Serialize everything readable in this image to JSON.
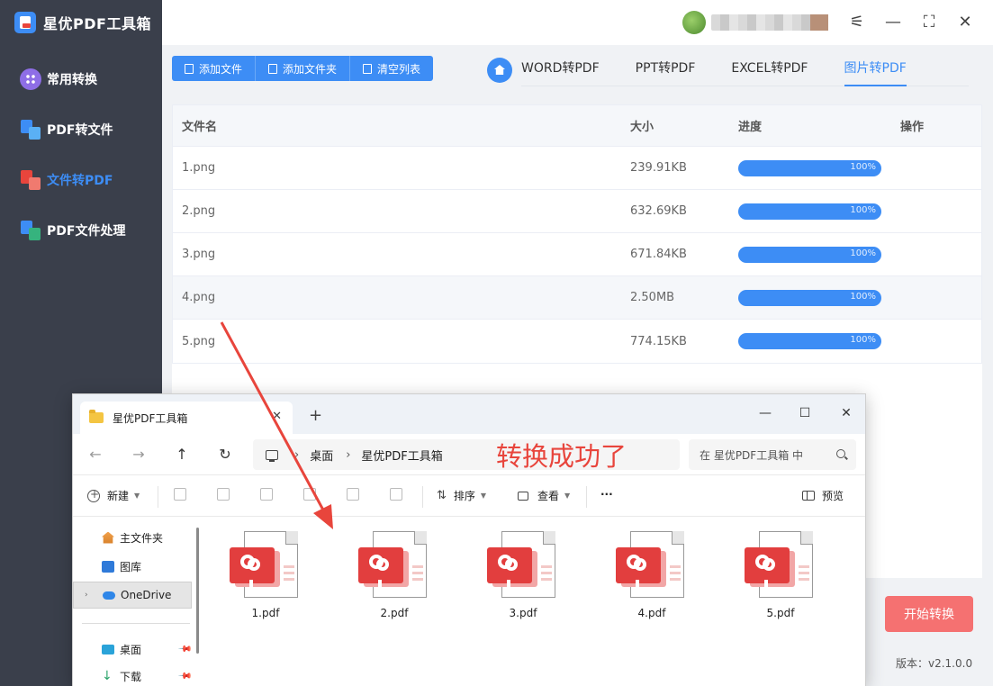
{
  "app": {
    "title": "星优PDF工具箱",
    "accent_color": "#3d8df5",
    "version_label": "版本：v2.1.0.0"
  },
  "sidebar": {
    "items": [
      {
        "label": "常用转换",
        "icon": "grid-icon"
      },
      {
        "label": "PDF转文件",
        "icon": "pdf-to-file-icon"
      },
      {
        "label": "文件转PDF",
        "icon": "file-to-pdf-icon",
        "active": true
      },
      {
        "label": "PDF文件处理",
        "icon": "pdf-process-icon"
      }
    ]
  },
  "window_controls": [
    "settings-icon",
    "minimize-icon",
    "maximize-icon",
    "close-icon"
  ],
  "toolbar": {
    "add_file": "添加文件",
    "add_folder": "添加文件夹",
    "clear_list": "清空列表"
  },
  "tabs": [
    {
      "label": "WORD转PDF"
    },
    {
      "label": "PPT转PDF"
    },
    {
      "label": "EXCEL转PDF"
    },
    {
      "label": "图片转PDF",
      "active": true
    }
  ],
  "table": {
    "headers": {
      "name": "文件名",
      "size": "大小",
      "progress": "进度",
      "action": "操作"
    },
    "rows": [
      {
        "name": "1.png",
        "size": "239.91KB",
        "progress_label": "100%",
        "progress": 1.0
      },
      {
        "name": "2.png",
        "size": "632.69KB",
        "progress_label": "100%",
        "progress": 1.0
      },
      {
        "name": "3.png",
        "size": "671.84KB",
        "progress_label": "100%",
        "progress": 1.0
      },
      {
        "name": "4.png",
        "size": "2.50MB",
        "progress_label": "100%",
        "progress": 1.0
      },
      {
        "name": "5.png",
        "size": "774.15KB",
        "progress_label": "100%",
        "progress": 1.0
      }
    ]
  },
  "start_button": "开始转换",
  "start_button_color": "#f57171",
  "explorer": {
    "tab_title": "星优PDF工具箱",
    "breadcrumb": [
      "桌面",
      "星优PDF工具箱"
    ],
    "annotation": "转换成功了",
    "annotation_color": "#e8453c",
    "search_placeholder": "在 星优PDF工具箱 中",
    "commands": {
      "new": "新建",
      "sort": "排序",
      "view": "查看",
      "more": "···",
      "preview": "预览"
    },
    "nav": [
      {
        "label": "主文件夹",
        "icon": "home-icon"
      },
      {
        "label": "图库",
        "icon": "gallery-icon"
      },
      {
        "label": "OneDrive",
        "icon": "cloud-icon",
        "selected": true
      },
      {
        "label": "桌面",
        "icon": "desktop-icon"
      },
      {
        "label": "下载",
        "icon": "download-icon"
      }
    ],
    "files": [
      "1.pdf",
      "2.pdf",
      "3.pdf",
      "4.pdf",
      "5.pdf"
    ]
  }
}
